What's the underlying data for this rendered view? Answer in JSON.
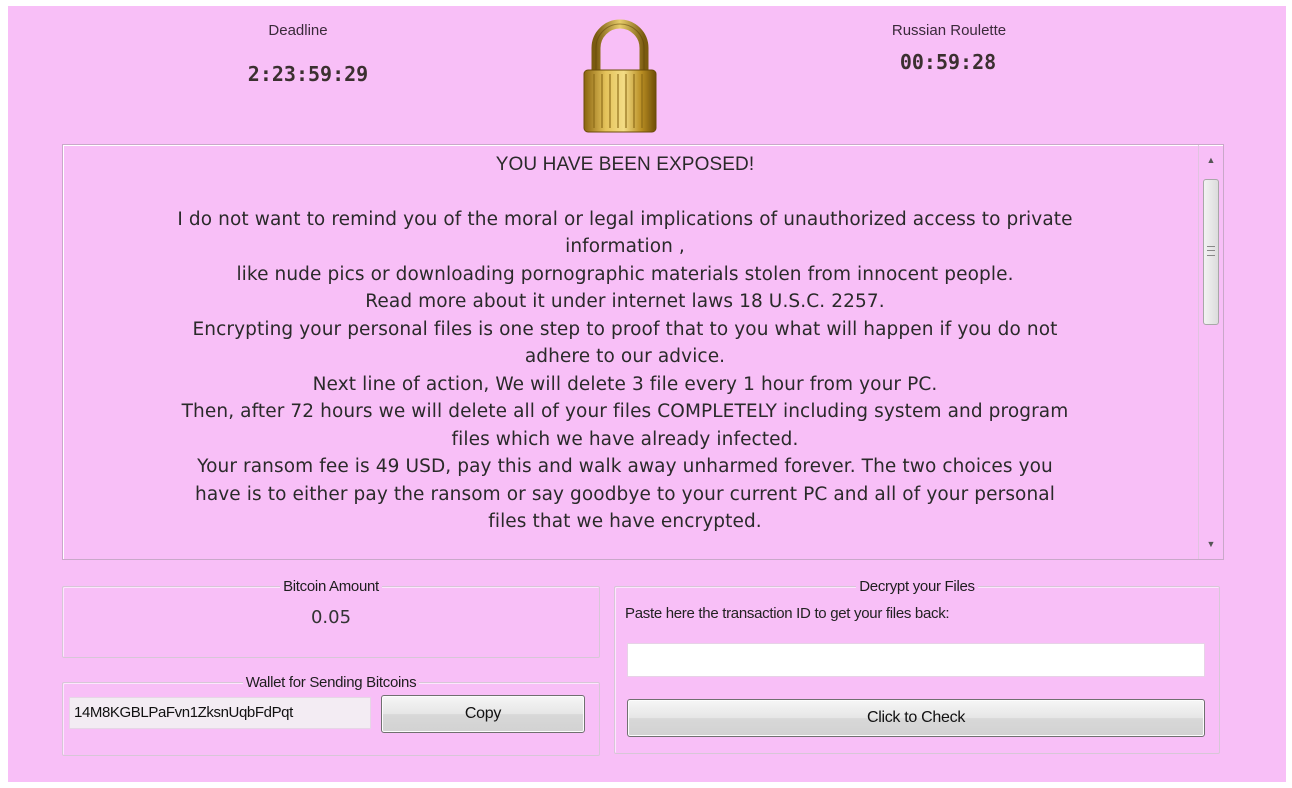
{
  "deadline": {
    "label": "Deadline",
    "value": "2:23:59:29"
  },
  "roulette": {
    "label": "Russian Roulette",
    "value": "00:59:28"
  },
  "message": {
    "title": "YOU HAVE BEEN EXPOSED!",
    "lines": [
      "I do not want to remind you of the moral or legal implications of unauthorized access to private",
      "information ,",
      "like nude pics or downloading pornographic materials stolen from innocent people.",
      "Read more about it under internet laws 18 U.S.C. 2257.",
      "Encrypting your personal files is one step to proof that to you what will happen if you do not",
      "adhere to our advice.",
      "Next line of action, We will delete 3 file every 1 hour from your PC.",
      "Then, after 72 hours we will delete all of your files COMPLETELY including system and program",
      "files which we have already infected.",
      "Your ransom fee is 49 USD, pay this and walk away unharmed forever. The two choices you",
      "have is to either pay the ransom or say goodbye to your current PC and all of your personal",
      "files that we have encrypted."
    ]
  },
  "bitcoin": {
    "title": "Bitcoin Amount",
    "amount": "0.05"
  },
  "wallet": {
    "title": "Wallet for Sending Bitcoins",
    "address": "14M8KGBLPaFvn1ZksnUqbFdPqt",
    "copy_label": "Copy"
  },
  "decrypt": {
    "title": "Decrypt your Files",
    "hint": "Paste here the transaction ID to get your files back:",
    "input_value": "",
    "check_label": "Click to Check"
  },
  "colors": {
    "background": "#f8bff7",
    "lock_gold": "#c9a227"
  },
  "icons": {
    "lock": "padlock-icon",
    "scroll_up": "arrow-up-icon",
    "scroll_down": "arrow-down-icon"
  }
}
